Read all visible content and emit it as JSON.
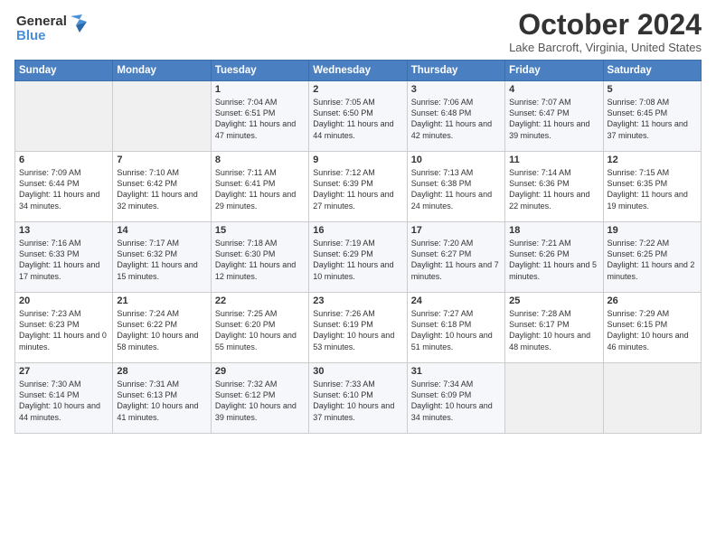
{
  "header": {
    "logo_line1": "General",
    "logo_line2": "Blue",
    "month_title": "October 2024",
    "location": "Lake Barcroft, Virginia, United States"
  },
  "days_of_week": [
    "Sunday",
    "Monday",
    "Tuesday",
    "Wednesday",
    "Thursday",
    "Friday",
    "Saturday"
  ],
  "weeks": [
    [
      {
        "num": "",
        "sunrise": "",
        "sunset": "",
        "daylight": ""
      },
      {
        "num": "",
        "sunrise": "",
        "sunset": "",
        "daylight": ""
      },
      {
        "num": "1",
        "sunrise": "Sunrise: 7:04 AM",
        "sunset": "Sunset: 6:51 PM",
        "daylight": "Daylight: 11 hours and 47 minutes."
      },
      {
        "num": "2",
        "sunrise": "Sunrise: 7:05 AM",
        "sunset": "Sunset: 6:50 PM",
        "daylight": "Daylight: 11 hours and 44 minutes."
      },
      {
        "num": "3",
        "sunrise": "Sunrise: 7:06 AM",
        "sunset": "Sunset: 6:48 PM",
        "daylight": "Daylight: 11 hours and 42 minutes."
      },
      {
        "num": "4",
        "sunrise": "Sunrise: 7:07 AM",
        "sunset": "Sunset: 6:47 PM",
        "daylight": "Daylight: 11 hours and 39 minutes."
      },
      {
        "num": "5",
        "sunrise": "Sunrise: 7:08 AM",
        "sunset": "Sunset: 6:45 PM",
        "daylight": "Daylight: 11 hours and 37 minutes."
      }
    ],
    [
      {
        "num": "6",
        "sunrise": "Sunrise: 7:09 AM",
        "sunset": "Sunset: 6:44 PM",
        "daylight": "Daylight: 11 hours and 34 minutes."
      },
      {
        "num": "7",
        "sunrise": "Sunrise: 7:10 AM",
        "sunset": "Sunset: 6:42 PM",
        "daylight": "Daylight: 11 hours and 32 minutes."
      },
      {
        "num": "8",
        "sunrise": "Sunrise: 7:11 AM",
        "sunset": "Sunset: 6:41 PM",
        "daylight": "Daylight: 11 hours and 29 minutes."
      },
      {
        "num": "9",
        "sunrise": "Sunrise: 7:12 AM",
        "sunset": "Sunset: 6:39 PM",
        "daylight": "Daylight: 11 hours and 27 minutes."
      },
      {
        "num": "10",
        "sunrise": "Sunrise: 7:13 AM",
        "sunset": "Sunset: 6:38 PM",
        "daylight": "Daylight: 11 hours and 24 minutes."
      },
      {
        "num": "11",
        "sunrise": "Sunrise: 7:14 AM",
        "sunset": "Sunset: 6:36 PM",
        "daylight": "Daylight: 11 hours and 22 minutes."
      },
      {
        "num": "12",
        "sunrise": "Sunrise: 7:15 AM",
        "sunset": "Sunset: 6:35 PM",
        "daylight": "Daylight: 11 hours and 19 minutes."
      }
    ],
    [
      {
        "num": "13",
        "sunrise": "Sunrise: 7:16 AM",
        "sunset": "Sunset: 6:33 PM",
        "daylight": "Daylight: 11 hours and 17 minutes."
      },
      {
        "num": "14",
        "sunrise": "Sunrise: 7:17 AM",
        "sunset": "Sunset: 6:32 PM",
        "daylight": "Daylight: 11 hours and 15 minutes."
      },
      {
        "num": "15",
        "sunrise": "Sunrise: 7:18 AM",
        "sunset": "Sunset: 6:30 PM",
        "daylight": "Daylight: 11 hours and 12 minutes."
      },
      {
        "num": "16",
        "sunrise": "Sunrise: 7:19 AM",
        "sunset": "Sunset: 6:29 PM",
        "daylight": "Daylight: 11 hours and 10 minutes."
      },
      {
        "num": "17",
        "sunrise": "Sunrise: 7:20 AM",
        "sunset": "Sunset: 6:27 PM",
        "daylight": "Daylight: 11 hours and 7 minutes."
      },
      {
        "num": "18",
        "sunrise": "Sunrise: 7:21 AM",
        "sunset": "Sunset: 6:26 PM",
        "daylight": "Daylight: 11 hours and 5 minutes."
      },
      {
        "num": "19",
        "sunrise": "Sunrise: 7:22 AM",
        "sunset": "Sunset: 6:25 PM",
        "daylight": "Daylight: 11 hours and 2 minutes."
      }
    ],
    [
      {
        "num": "20",
        "sunrise": "Sunrise: 7:23 AM",
        "sunset": "Sunset: 6:23 PM",
        "daylight": "Daylight: 11 hours and 0 minutes."
      },
      {
        "num": "21",
        "sunrise": "Sunrise: 7:24 AM",
        "sunset": "Sunset: 6:22 PM",
        "daylight": "Daylight: 10 hours and 58 minutes."
      },
      {
        "num": "22",
        "sunrise": "Sunrise: 7:25 AM",
        "sunset": "Sunset: 6:20 PM",
        "daylight": "Daylight: 10 hours and 55 minutes."
      },
      {
        "num": "23",
        "sunrise": "Sunrise: 7:26 AM",
        "sunset": "Sunset: 6:19 PM",
        "daylight": "Daylight: 10 hours and 53 minutes."
      },
      {
        "num": "24",
        "sunrise": "Sunrise: 7:27 AM",
        "sunset": "Sunset: 6:18 PM",
        "daylight": "Daylight: 10 hours and 51 minutes."
      },
      {
        "num": "25",
        "sunrise": "Sunrise: 7:28 AM",
        "sunset": "Sunset: 6:17 PM",
        "daylight": "Daylight: 10 hours and 48 minutes."
      },
      {
        "num": "26",
        "sunrise": "Sunrise: 7:29 AM",
        "sunset": "Sunset: 6:15 PM",
        "daylight": "Daylight: 10 hours and 46 minutes."
      }
    ],
    [
      {
        "num": "27",
        "sunrise": "Sunrise: 7:30 AM",
        "sunset": "Sunset: 6:14 PM",
        "daylight": "Daylight: 10 hours and 44 minutes."
      },
      {
        "num": "28",
        "sunrise": "Sunrise: 7:31 AM",
        "sunset": "Sunset: 6:13 PM",
        "daylight": "Daylight: 10 hours and 41 minutes."
      },
      {
        "num": "29",
        "sunrise": "Sunrise: 7:32 AM",
        "sunset": "Sunset: 6:12 PM",
        "daylight": "Daylight: 10 hours and 39 minutes."
      },
      {
        "num": "30",
        "sunrise": "Sunrise: 7:33 AM",
        "sunset": "Sunset: 6:10 PM",
        "daylight": "Daylight: 10 hours and 37 minutes."
      },
      {
        "num": "31",
        "sunrise": "Sunrise: 7:34 AM",
        "sunset": "Sunset: 6:09 PM",
        "daylight": "Daylight: 10 hours and 34 minutes."
      },
      {
        "num": "",
        "sunrise": "",
        "sunset": "",
        "daylight": ""
      },
      {
        "num": "",
        "sunrise": "",
        "sunset": "",
        "daylight": ""
      }
    ]
  ]
}
